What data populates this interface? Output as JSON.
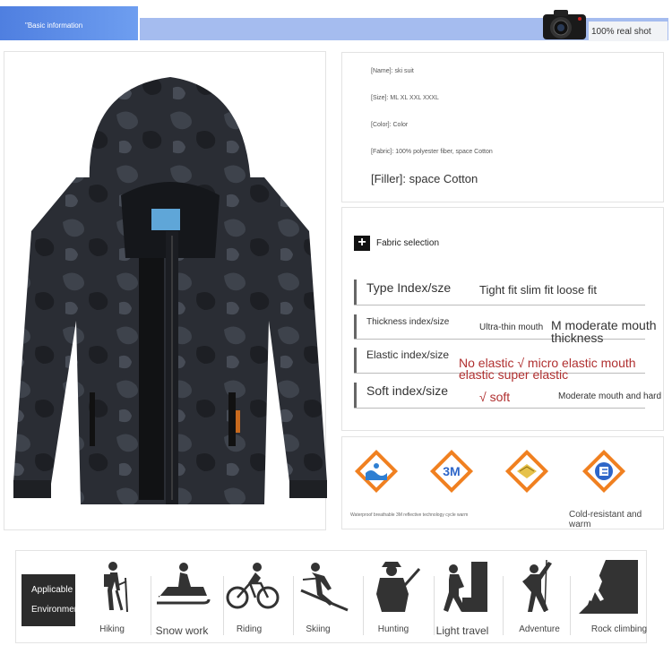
{
  "header": {
    "section_title": "\"Basic information",
    "real_shot": "100% real shot"
  },
  "info": {
    "name": "[Name]: ski suit",
    "size": "[Size]: ML XL XXL XXXL",
    "color": "[Color]: Color",
    "fabric": "[Fabric]: 100% polyester fiber, space Cotton",
    "filler": "[Filler]: space Cotton"
  },
  "fabric_selection": {
    "title": "Fabric selection",
    "type_label": "Type Index/sze",
    "type_options": "Tight fit slim fit loose fit",
    "thickness_label": "Thickness index/size",
    "thickness_opt1": "Ultra-thin mouth",
    "thickness_opt2": "M moderate mouth thickness",
    "elastic_label": "Elastic index/size",
    "elastic_options": "No elastic √ micro elastic mouth elastic super elastic",
    "soft_label": "Soft index/size",
    "soft_opt1": "√ soft",
    "soft_opt2": "Moderate mouth and hard"
  },
  "features": {
    "caption_small": "Waterproof breathable 3M reflective technology cycle warm",
    "cold": "Cold-resistant and warm"
  },
  "environment": {
    "title": "Applicable Environment",
    "items": [
      {
        "label": "Hiking",
        "icon": "hiking-icon"
      },
      {
        "label": "Snow work",
        "icon": "snowmobile-icon"
      },
      {
        "label": "Riding",
        "icon": "bicycle-icon"
      },
      {
        "label": "Skiing",
        "icon": "skiing-icon"
      },
      {
        "label": "Hunting",
        "icon": "hunting-icon"
      },
      {
        "label": "Light travel",
        "icon": "travel-icon"
      },
      {
        "label": "Adventure",
        "icon": "climbing-icon"
      },
      {
        "label": "Rock climbing",
        "icon": "rock-climbing-icon"
      }
    ]
  },
  "colors": {
    "header_blue": "#4f7fe0",
    "header_bar": "#a5bcef",
    "badge_orange": "#f08020",
    "option_red": "#b03030"
  }
}
